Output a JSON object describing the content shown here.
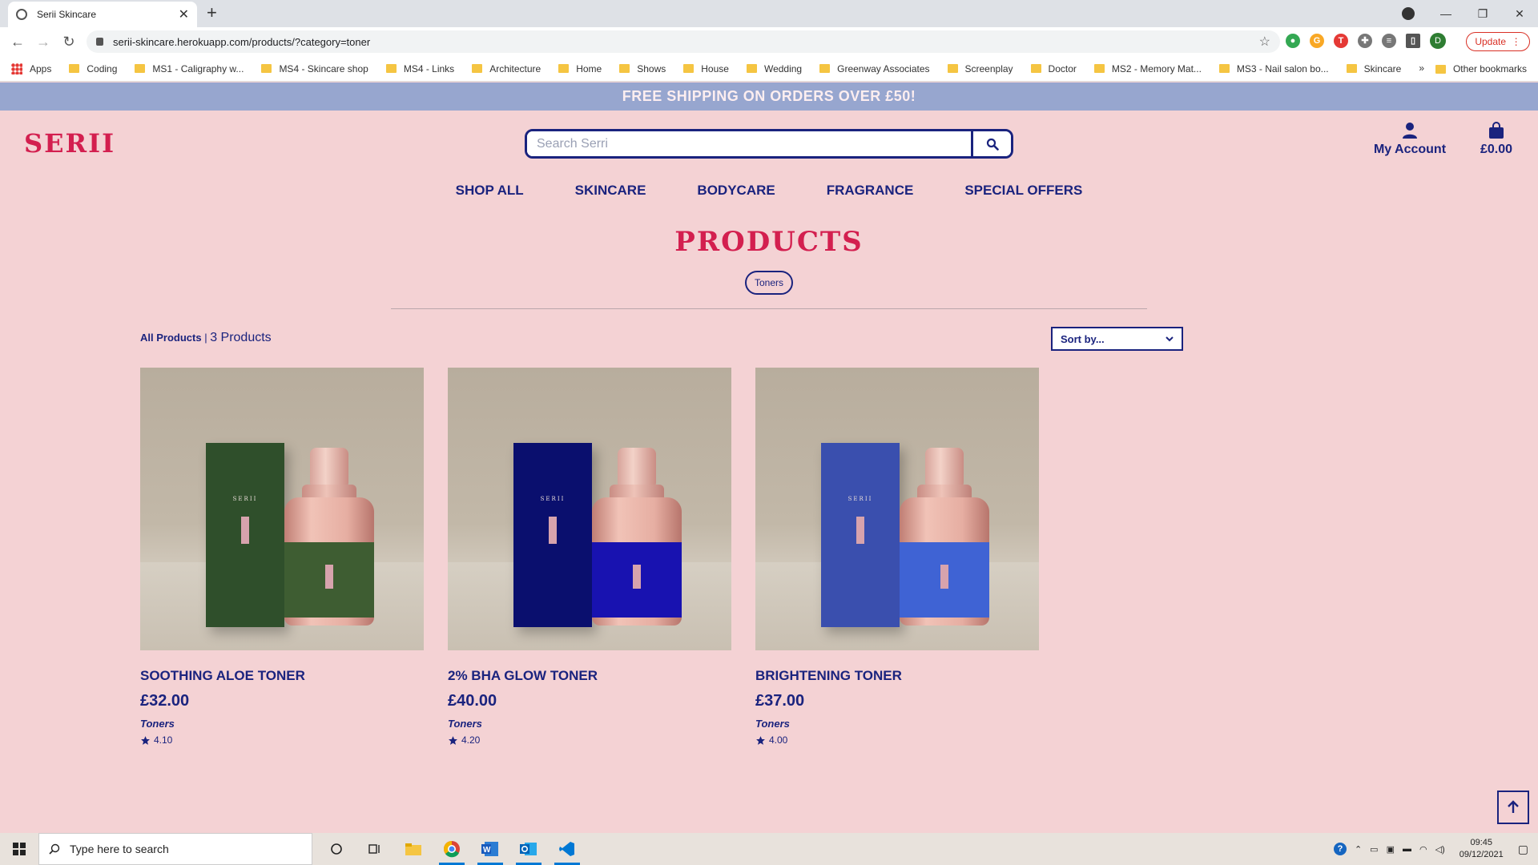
{
  "browser": {
    "tab_title": "Serii Skincare",
    "url": "serii-skincare.herokuapp.com/products/?category=toner",
    "update_label": "Update",
    "profile_initial": "D",
    "bookmarks": [
      "Apps",
      "Coding",
      "MS1 - Caligraphy w...",
      "MS4 - Skincare shop",
      "MS4 - Links",
      "Architecture",
      "Home",
      "Shows",
      "House",
      "Wedding",
      "Greenway Associates",
      "Screenplay",
      "Doctor",
      "MS2 - Memory Mat...",
      "MS3 - Nail salon bo...",
      "Skincare"
    ],
    "bookmarks_more": "»",
    "other_bookmarks": "Other bookmarks"
  },
  "site": {
    "banner": "FREE SHIPPING ON ORDERS OVER £50!",
    "logo": "SERII",
    "search_placeholder": "Search Serri",
    "account_label": "My Account",
    "bag_total": "£0.00",
    "nav": [
      "SHOP ALL",
      "SKINCARE",
      "BODYCARE",
      "FRAGRANCE",
      "SPECIAL OFFERS"
    ],
    "page_title": "PRODUCTS",
    "category_pill": "Toners",
    "all_products_link": "All Products",
    "separator": " | ",
    "product_count": "3 Products",
    "sort_label": "Sort by...",
    "colors": {
      "accent": "#d31f4f",
      "navy": "#1a237e",
      "background": "#f4d2d4",
      "banner": "#97a6cf"
    }
  },
  "products": [
    {
      "name": "SOOTHING ALOE TONER",
      "price": "£32.00",
      "category": "Toners",
      "rating": "4.10",
      "box_color": "#2f4f2b",
      "label_color": "#3e5d32",
      "box_brand": "SERII"
    },
    {
      "name": "2% BHA GLOW TONER",
      "price": "£40.00",
      "category": "Toners",
      "rating": "4.20",
      "box_color": "#0a0f6e",
      "label_color": "#1812b0",
      "box_brand": "SERII"
    },
    {
      "name": "BRIGHTENING TONER",
      "price": "£37.00",
      "category": "Toners",
      "rating": "4.00",
      "box_color": "#3a4fae",
      "label_color": "#3f63d4",
      "box_brand": "SERII"
    }
  ],
  "taskbar": {
    "search_placeholder": "Type here to search",
    "time": "09:45",
    "date": "09/12/2021"
  }
}
